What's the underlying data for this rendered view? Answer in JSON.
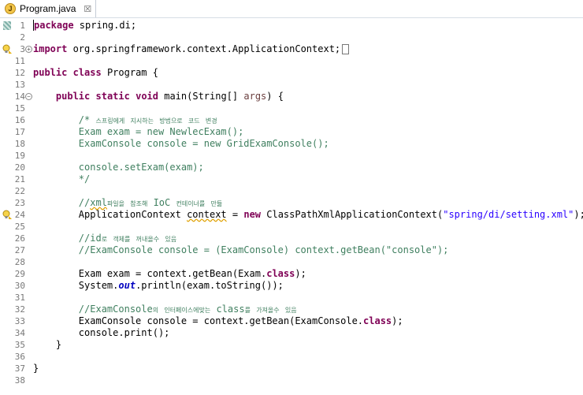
{
  "tab": {
    "title": "Program.java",
    "icon": "java-file-icon",
    "close_symbol": "☒"
  },
  "lines": [
    {
      "n": "1",
      "t": "package spring.di;"
    },
    {
      "n": "2",
      "t": ""
    },
    {
      "n": "3",
      "t": "import org.springframework.context.ApplicationContext;"
    },
    {
      "n": "11",
      "t": ""
    },
    {
      "n": "12",
      "t": "public class Program {"
    },
    {
      "n": "13",
      "t": ""
    },
    {
      "n": "14",
      "t": "    public static void main(String[] args) {"
    },
    {
      "n": "15",
      "t": ""
    },
    {
      "n": "16",
      "t": "        /* 스프링에게 지시하는 방법으로 코드 변경"
    },
    {
      "n": "17",
      "t": "        Exam exam = new NewlecExam();"
    },
    {
      "n": "18",
      "t": "        ExamConsole console = new GridExamConsole();"
    },
    {
      "n": "19",
      "t": ""
    },
    {
      "n": "20",
      "t": "        console.setExam(exam);"
    },
    {
      "n": "21",
      "t": "        */"
    },
    {
      "n": "22",
      "t": ""
    },
    {
      "n": "23",
      "t": "        //xml파일을 참조해 IoC 컨테이너를 만듦"
    },
    {
      "n": "24",
      "t": "        ApplicationContext context = new ClassPathXmlApplicationContext(\"spring/di/setting.xml\");"
    },
    {
      "n": "25",
      "t": ""
    },
    {
      "n": "26",
      "t": "        //id로 객체를 꺼내올수 있음"
    },
    {
      "n": "27",
      "t": "        //ExamConsole console = (ExamConsole) context.getBean(\"console\");"
    },
    {
      "n": "28",
      "t": ""
    },
    {
      "n": "29",
      "t": "        Exam exam = context.getBean(Exam.class);"
    },
    {
      "n": "30",
      "t": "        System.out.println(exam.toString());"
    },
    {
      "n": "31",
      "t": ""
    },
    {
      "n": "32",
      "t": "        //ExamConsole의 인터페이스에맞는 class를 가져올수 있음"
    },
    {
      "n": "33",
      "t": "        ExamConsole console = context.getBean(ExamConsole.class);"
    },
    {
      "n": "34",
      "t": "        console.print();"
    },
    {
      "n": "35",
      "t": "    }"
    },
    {
      "n": "36",
      "t": ""
    },
    {
      "n": "37",
      "t": "}"
    },
    {
      "n": "38",
      "t": ""
    }
  ],
  "colors": {
    "keyword": "#7f0055",
    "comment": "#3f7f5f",
    "string": "#2a00ff",
    "field": "#0000c0"
  }
}
